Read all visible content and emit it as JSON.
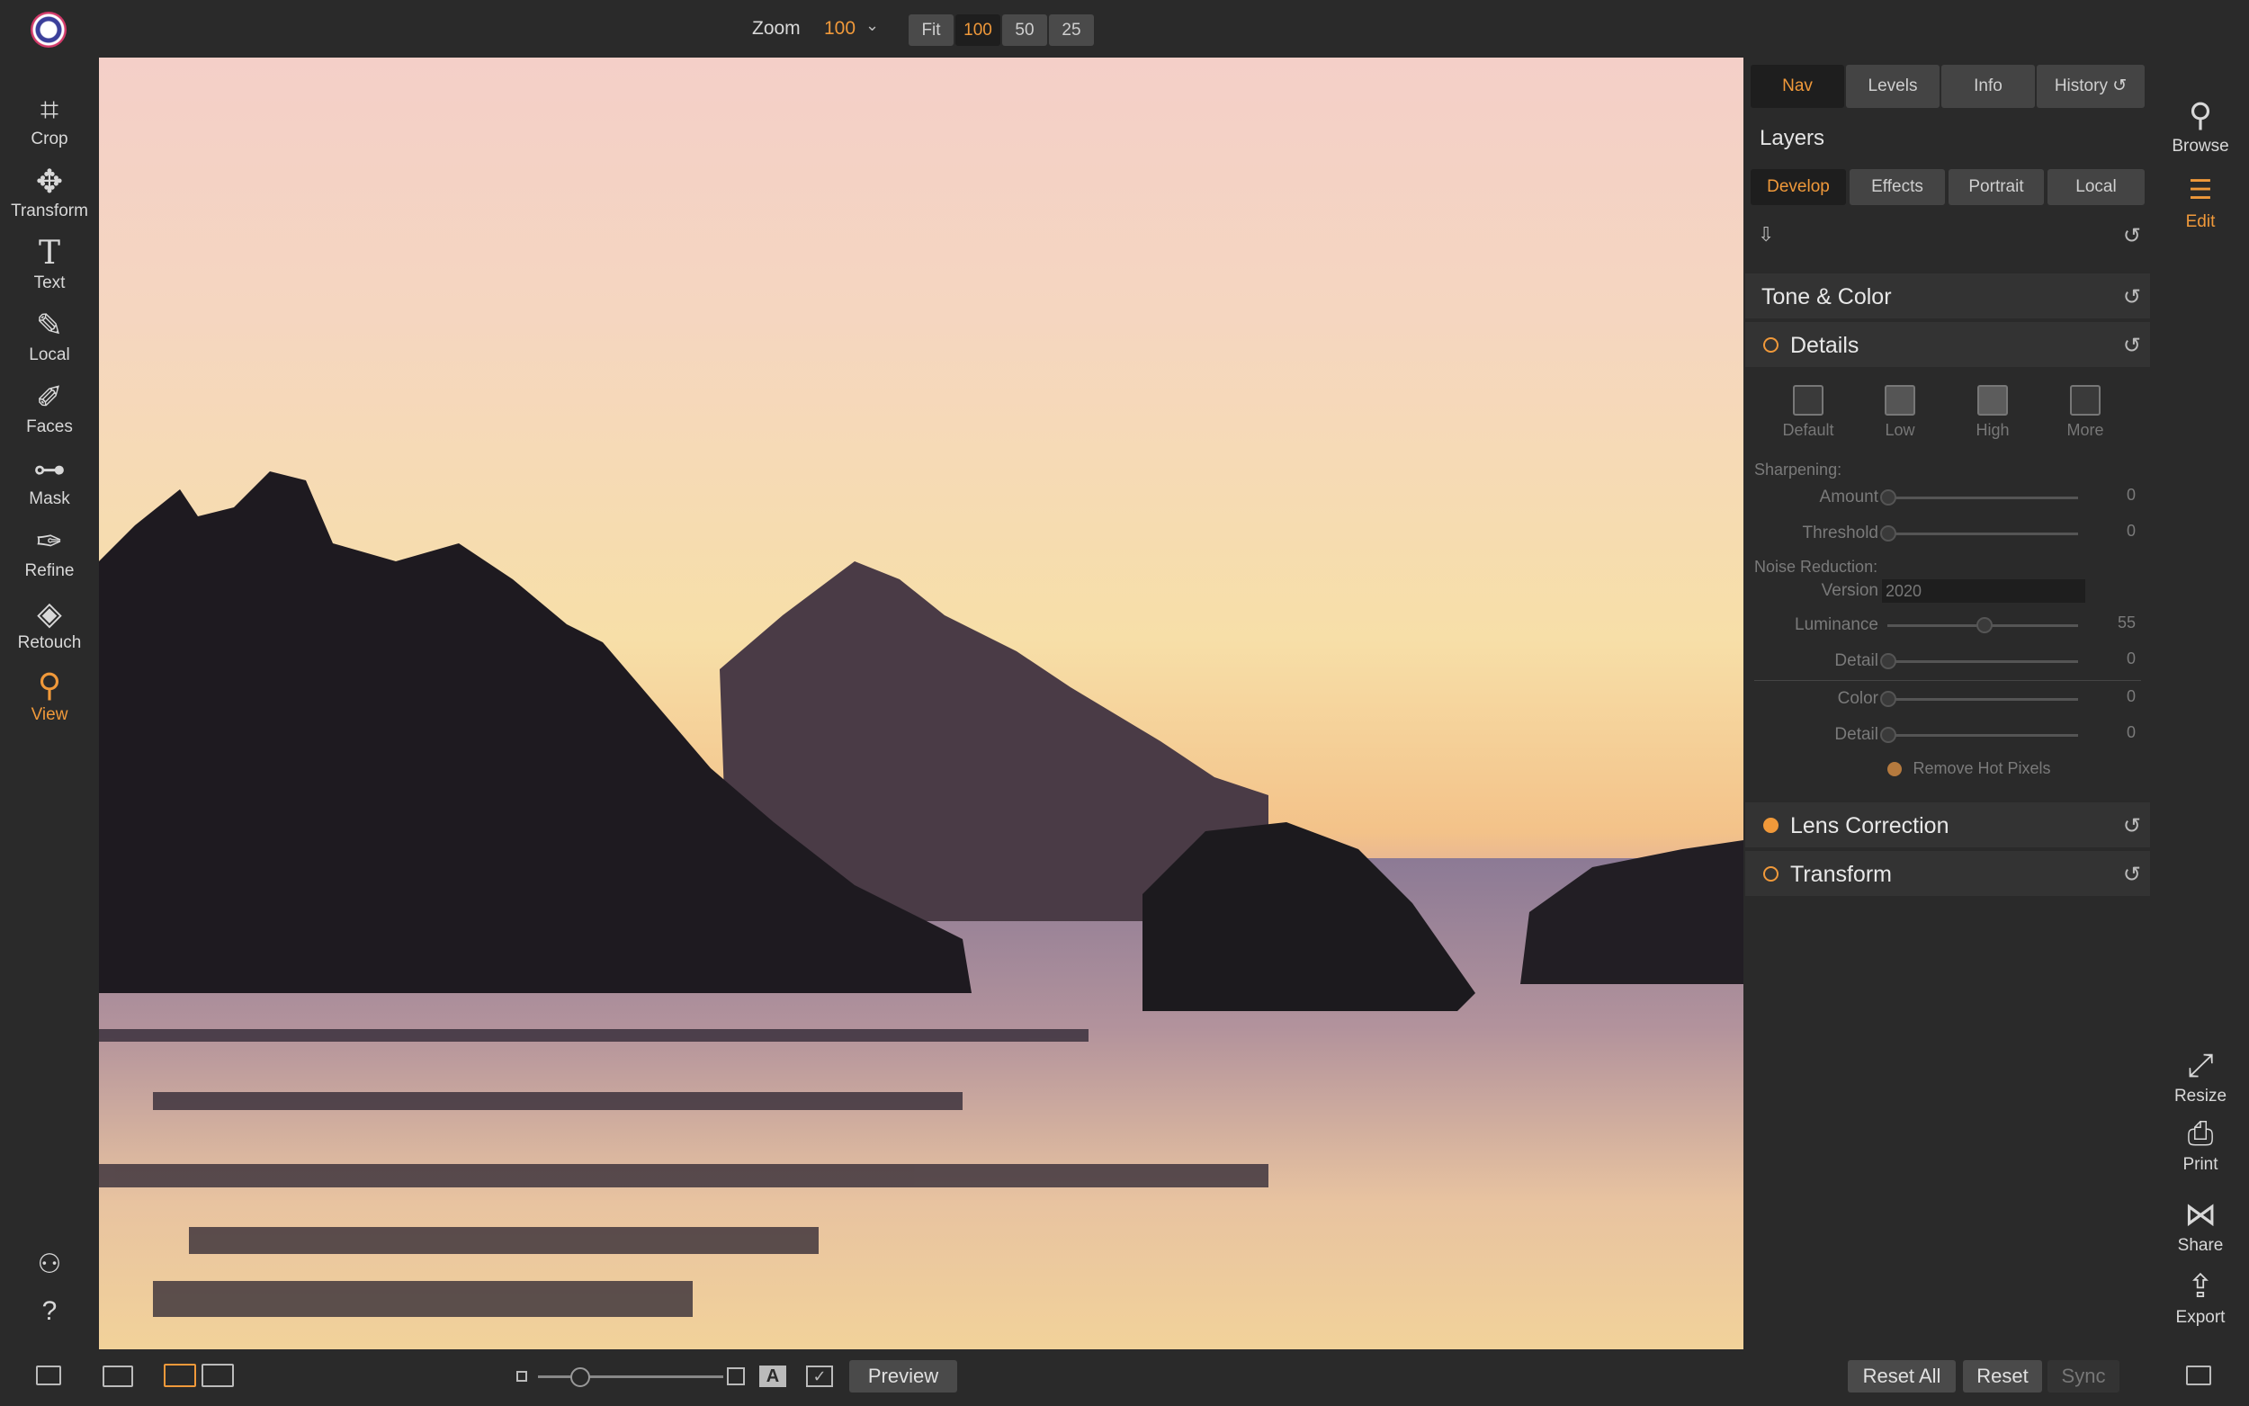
{
  "topbar": {
    "zoom_label": "Zoom",
    "zoom_value": "100",
    "zoom_buttons": [
      "Fit",
      "100",
      "50",
      "25"
    ]
  },
  "left_tools": [
    {
      "label": "Crop",
      "icon": "crop-icon"
    },
    {
      "label": "Transform",
      "icon": "move-icon"
    },
    {
      "label": "Text",
      "icon": "text-icon"
    },
    {
      "label": "Local",
      "icon": "brush-icon"
    },
    {
      "label": "Faces",
      "icon": "face-brush-icon"
    },
    {
      "label": "Mask",
      "icon": "mask-icon"
    },
    {
      "label": "Refine",
      "icon": "refine-brush-icon"
    },
    {
      "label": "Retouch",
      "icon": "retouch-icon"
    },
    {
      "label": "View",
      "icon": "view-hand-icon"
    }
  ],
  "panel": {
    "top_tabs": [
      "Nav",
      "Levels",
      "Info",
      "History"
    ],
    "layers_title": "Layers",
    "sub_tabs": [
      "Develop",
      "Effects",
      "Portrait",
      "Local"
    ],
    "tone_color": "Tone & Color",
    "details": "Details",
    "presets": [
      "Default",
      "Low",
      "High",
      "More"
    ],
    "sharpening_label": "Sharpening:",
    "amount_label": "Amount",
    "amount_value": "0",
    "threshold_label": "Threshold",
    "threshold_value": "0",
    "noise_label": "Noise Reduction:",
    "version_label": "Version",
    "version_value": "2020",
    "luminance_label": "Luminance",
    "luminance_value": "55",
    "detail_label": "Detail",
    "detail_value": "0",
    "color_label": "Color",
    "color_value": "0",
    "detail2_label": "Detail",
    "detail2_value": "0",
    "hot_pixels_label": "Remove Hot Pixels",
    "lens_correction": "Lens Correction",
    "transform": "Transform"
  },
  "right_tools": {
    "browse": "Browse",
    "edit": "Edit",
    "resize": "Resize",
    "print": "Print",
    "share": "Share",
    "export": "Export"
  },
  "bottombar": {
    "preview": "Preview",
    "reset_all": "Reset All",
    "reset": "Reset",
    "sync": "Sync"
  },
  "colors": {
    "accent": "#f0993a",
    "background": "#2a2a2a"
  }
}
